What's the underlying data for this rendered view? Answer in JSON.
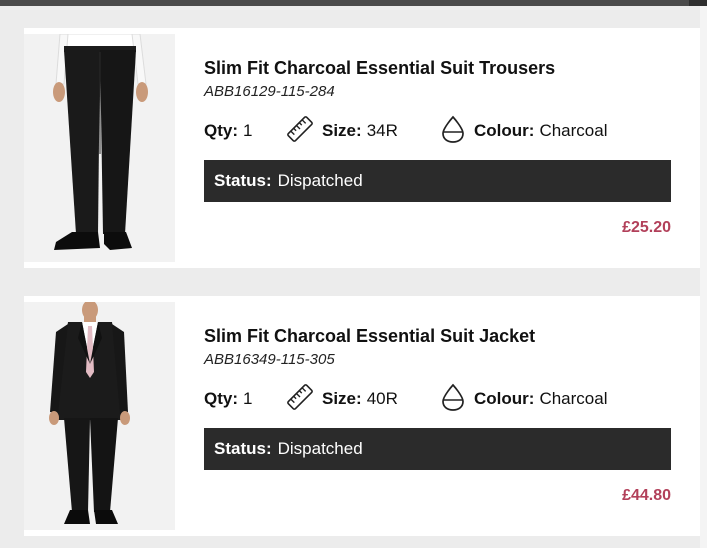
{
  "colors": {
    "accent_price": "#b2405a",
    "status_bg": "#2b2b2b",
    "page_bg": "#ececec"
  },
  "labels": {
    "qty": "Qty:",
    "size": "Size:",
    "colour": "Colour:",
    "status": "Status:"
  },
  "items": [
    {
      "title": "Slim Fit Charcoal Essential Suit Trousers",
      "sku": "ABB16129-115-284",
      "qty": "1",
      "size": "34R",
      "colour": "Charcoal",
      "status": "Dispatched",
      "price": "£25.20",
      "image": "charcoal-suit-trousers-photo"
    },
    {
      "title": "Slim Fit Charcoal Essential Suit Jacket",
      "sku": "ABB16349-115-305",
      "qty": "1",
      "size": "40R",
      "colour": "Charcoal",
      "status": "Dispatched",
      "price": "£44.80",
      "image": "charcoal-suit-jacket-photo"
    }
  ],
  "icons": {
    "size": "ruler-icon",
    "colour": "water-drop-icon"
  }
}
